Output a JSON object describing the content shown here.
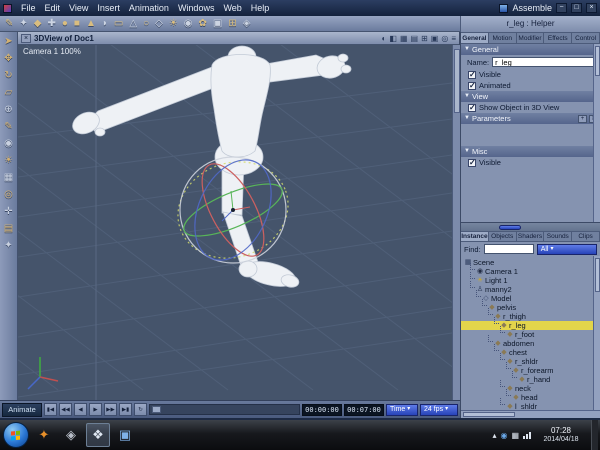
{
  "colors": {
    "accent_blue": "#2e4fd4",
    "selection_yellow": "#e3d54b",
    "viewport_bg": "#45546b",
    "panel_bg": "#8593b0"
  },
  "menubar": {
    "items": [
      "File",
      "Edit",
      "View",
      "Insert",
      "Animation",
      "Windows",
      "Web",
      "Help"
    ],
    "room": "Assemble",
    "window_controls": [
      "−",
      "□",
      "×"
    ]
  },
  "toolbar": {
    "icons": [
      "✎",
      "✦",
      "◆",
      "✚",
      "●",
      "■",
      "▲",
      "◗",
      "▭",
      "△",
      "○",
      "◇",
      "☀",
      "◉",
      "✿",
      "▣",
      "⊞",
      "◈"
    ]
  },
  "context_bar": {
    "label": "r_leg : Helper"
  },
  "left_toolbar": {
    "icons": [
      "➤",
      "✥",
      "↻",
      "▱",
      "⊕",
      "✎",
      "◉",
      "☀",
      "▦",
      "◎",
      "✛",
      "▤",
      "✦"
    ]
  },
  "viewport": {
    "title": "3DView of Doc1",
    "close_glyph": "×",
    "camera_label": "Camera 1 100%",
    "header_icons": [
      "◐",
      "◧",
      "▦",
      "▤",
      "⊞",
      "▣",
      "◎",
      "≡"
    ]
  },
  "properties": {
    "tabs": [
      "General",
      "Motion",
      "Modifier",
      "Effects",
      "Control"
    ],
    "active_tab": "General",
    "section_general": "General",
    "section_view": "View",
    "section_parameters": "Parameters",
    "section_misc": "Misc",
    "name_label": "Name:",
    "name_value": "r_leg",
    "general_checks": [
      {
        "label": "Visible",
        "checked": true
      },
      {
        "label": "Animated",
        "checked": true
      }
    ],
    "view_checks": [
      {
        "label": "Show Object in 3D View",
        "checked": true
      }
    ],
    "misc_checks": [
      {
        "label": "Visible",
        "checked": true
      }
    ],
    "param_buttons": [
      "+",
      "≡"
    ]
  },
  "browser": {
    "tabs": [
      "Instance",
      "Objects",
      "Shaders",
      "Sounds",
      "Clips"
    ],
    "active_tab": "Instance",
    "find_label": "Find:",
    "find_value": "",
    "filter_value": "All",
    "tree": [
      {
        "label": "Scene",
        "depth": 0,
        "icon": "scene"
      },
      {
        "label": "Camera 1",
        "depth": 1,
        "icon": "camera"
      },
      {
        "label": "Light 1",
        "depth": 1,
        "icon": "light"
      },
      {
        "label": "manny2",
        "depth": 1,
        "icon": "figure"
      },
      {
        "label": "Model",
        "depth": 2,
        "icon": "model"
      },
      {
        "label": "pelvis",
        "depth": 3,
        "icon": "joint"
      },
      {
        "label": "r_thigh",
        "depth": 4,
        "icon": "joint"
      },
      {
        "label": "r_leg",
        "depth": 5,
        "icon": "joint",
        "selected": true
      },
      {
        "label": "r_foot",
        "depth": 6,
        "icon": "joint"
      },
      {
        "label": "abdomen",
        "depth": 4,
        "icon": "joint"
      },
      {
        "label": "chest",
        "depth": 5,
        "icon": "joint"
      },
      {
        "label": "r_shldr",
        "depth": 6,
        "icon": "joint"
      },
      {
        "label": "r_forearm",
        "depth": 7,
        "icon": "joint"
      },
      {
        "label": "r_hand",
        "depth": 8,
        "icon": "joint"
      },
      {
        "label": "neck",
        "depth": 6,
        "icon": "joint"
      },
      {
        "label": "head",
        "depth": 7,
        "icon": "joint"
      },
      {
        "label": "l_shldr",
        "depth": 6,
        "icon": "joint"
      }
    ]
  },
  "timeline": {
    "animate_label": "Animate",
    "buttons": [
      "▮◀",
      "◀◀",
      "◀",
      "▶",
      "▶▶",
      "▶▮",
      "↻"
    ],
    "time_current": "00:00:00",
    "time_end": "00:07:00",
    "unit": "Time",
    "fps": "24 fps"
  },
  "taskbar": {
    "app_icons": [
      "✦",
      "◈",
      "❖",
      "▣"
    ],
    "tray_icons": [
      "▴",
      "◉",
      "▦"
    ],
    "clock_time": "07:28",
    "clock_date": "2014/04/18"
  }
}
